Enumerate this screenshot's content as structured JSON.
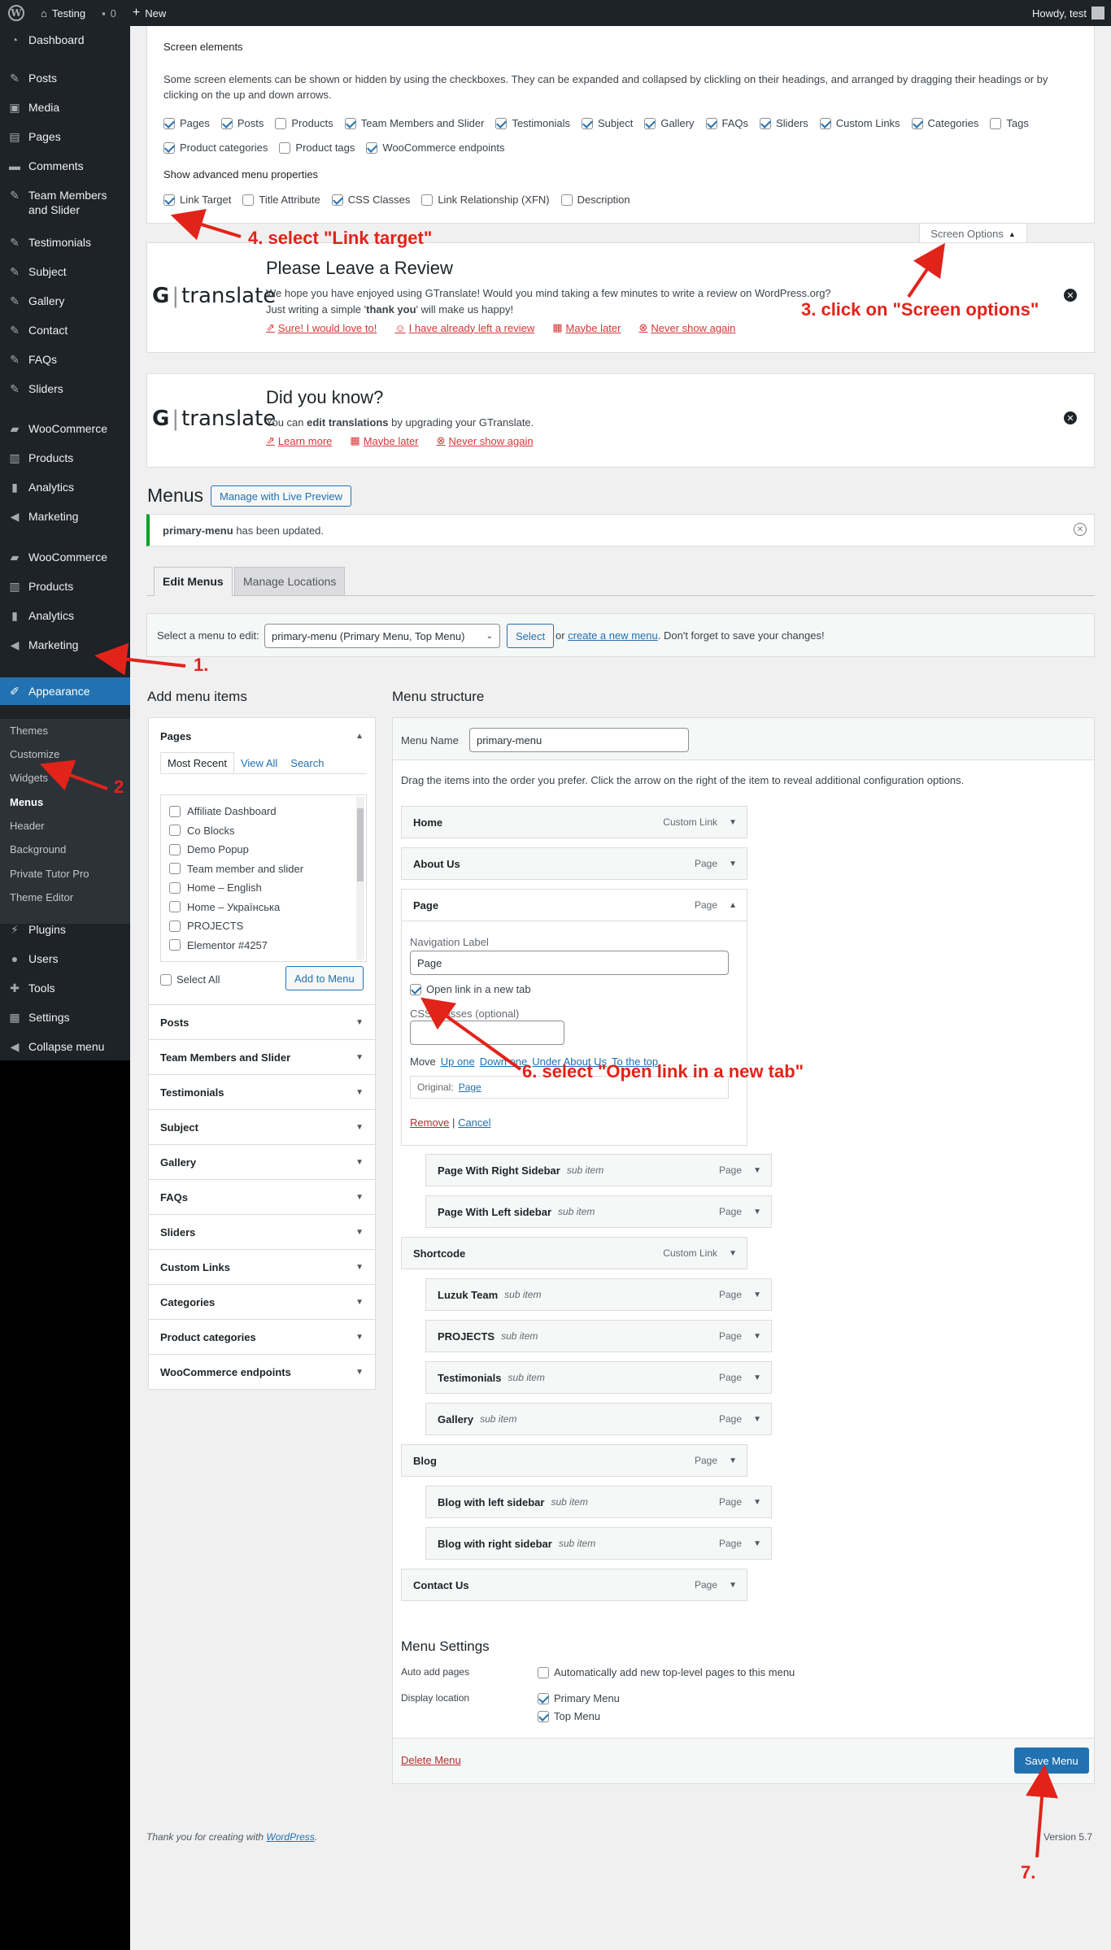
{
  "adminbar": {
    "site_name": "Testing",
    "comments_count": "0",
    "new_label": "New",
    "howdy": "Howdy, test"
  },
  "sidebar": {
    "items": [
      {
        "label": "Dashboard",
        "icon": "dashboard-icon"
      },
      {
        "label": "Posts",
        "icon": "pin-icon"
      },
      {
        "label": "Media",
        "icon": "media-icon"
      },
      {
        "label": "Pages",
        "icon": "page-icon"
      },
      {
        "label": "Comments",
        "icon": "comment-icon"
      },
      {
        "label": "Team Members\nand Slider",
        "icon": "pin-icon"
      },
      {
        "label": "Testimonials",
        "icon": "pin-icon"
      },
      {
        "label": "Subject",
        "icon": "pin-icon"
      },
      {
        "label": "Gallery",
        "icon": "pin-icon"
      },
      {
        "label": "Contact",
        "icon": "pin-icon"
      },
      {
        "label": "FAQs",
        "icon": "pin-icon"
      },
      {
        "label": "Sliders",
        "icon": "pin-icon"
      },
      {
        "label": "WooCommerce",
        "icon": "woo-icon"
      },
      {
        "label": "Products",
        "icon": "archive-icon"
      },
      {
        "label": "Analytics",
        "icon": "chart-icon"
      },
      {
        "label": "Marketing",
        "icon": "megaphone-icon"
      },
      {
        "label": "WooCommerce",
        "icon": "woo-icon"
      },
      {
        "label": "Products",
        "icon": "archive-icon"
      },
      {
        "label": "Analytics",
        "icon": "chart-icon"
      },
      {
        "label": "Marketing",
        "icon": "megaphone-icon"
      },
      {
        "label": "Appearance",
        "icon": "brush-icon"
      }
    ],
    "appearance_sub": [
      "Themes",
      "Customize",
      "Widgets",
      "Menus",
      "Header",
      "Background",
      "Private Tutor Pro",
      "Theme Editor"
    ],
    "after": [
      {
        "label": "Plugins",
        "icon": "plugin-icon"
      },
      {
        "label": "Users",
        "icon": "users-icon"
      },
      {
        "label": "Tools",
        "icon": "tools-icon"
      },
      {
        "label": "Settings",
        "icon": "settings-icon"
      },
      {
        "label": "Collapse menu",
        "icon": "collapse-icon"
      }
    ]
  },
  "screen_options": {
    "heading": "Screen elements",
    "description": "Some screen elements can be shown or hidden by using the checkboxes. They can be expanded and collapsed by clickling on their headings, and arranged by dragging their headings or by clicking on the up and down arrows.",
    "elements": [
      {
        "label": "Pages",
        "checked": true
      },
      {
        "label": "Posts",
        "checked": true
      },
      {
        "label": "Products",
        "checked": false
      },
      {
        "label": "Team Members and Slider",
        "checked": true
      },
      {
        "label": "Testimonials",
        "checked": true
      },
      {
        "label": "Subject",
        "checked": true
      },
      {
        "label": "Gallery",
        "checked": true
      },
      {
        "label": "FAQs",
        "checked": true
      },
      {
        "label": "Sliders",
        "checked": true
      },
      {
        "label": "Custom Links",
        "checked": true
      },
      {
        "label": "Categories",
        "checked": true
      },
      {
        "label": "Tags",
        "checked": false
      }
    ],
    "elements_row2": [
      {
        "label": "Product categories",
        "checked": true
      },
      {
        "label": "Product tags",
        "checked": false
      },
      {
        "label": "WooCommerce endpoints",
        "checked": true
      }
    ],
    "advanced_heading": "Show advanced menu properties",
    "advanced": [
      {
        "label": "Link Target",
        "checked": true
      },
      {
        "label": "Title Attribute",
        "checked": false
      },
      {
        "label": "CSS Classes",
        "checked": true
      },
      {
        "label": "Link Relationship (XFN)",
        "checked": false
      },
      {
        "label": "Description",
        "checked": false
      }
    ],
    "tab_label": "Screen Options"
  },
  "review_notice": {
    "logo_g": "G",
    "logo_text": "translate",
    "title": "Please Leave a Review",
    "line1": "We hope you have enjoyed using GTranslate! Would you mind taking a few minutes to write a review on WordPress.org?",
    "line2_pre": "Just writing a simple '",
    "line2_bold": "thank you",
    "line2_post": "' will make us happy!",
    "links": [
      "Sure! I would love to!",
      "I have already left a review",
      "Maybe later",
      "Never show again"
    ]
  },
  "dyk_notice": {
    "logo_g": "G",
    "logo_text": "translate",
    "title": "Did you know?",
    "line_pre": "You can ",
    "line_bold": "edit translations",
    "line_post": " by upgrading your GTranslate.",
    "links": [
      "Learn more",
      "Maybe later",
      "Never show again"
    ]
  },
  "menus": {
    "page_title": "Menus",
    "live_preview": "Manage with Live Preview",
    "updated_bold": "primary-menu",
    "updated_text": " has been updated.",
    "tab_edit": "Edit Menus",
    "tab_locations": "Manage Locations",
    "select_label": "Select a menu to edit:",
    "select_value": "primary-menu (Primary Menu, Top Menu)",
    "select_btn": "Select",
    "or_text": "or",
    "create_link": "create a new menu",
    "after_create": ". Don't forget to save your changes!"
  },
  "add_items": {
    "heading": "Add menu items",
    "pages_title": "Pages",
    "tabs": [
      "Most Recent",
      "View All",
      "Search"
    ],
    "pages": [
      "Affiliate Dashboard",
      "Co Blocks",
      "Demo Popup",
      "Team member and slider",
      "Home – English",
      "Home – Українська",
      "PROJECTS",
      "Elementor #4257"
    ],
    "select_all": "Select All",
    "add_btn": "Add to Menu",
    "sections": [
      "Posts",
      "Team Members and Slider",
      "Testimonials",
      "Subject",
      "Gallery",
      "FAQs",
      "Sliders",
      "Custom Links",
      "Categories",
      "Product categories",
      "WooCommerce endpoints"
    ]
  },
  "structure": {
    "heading": "Menu structure",
    "name_label": "Menu Name",
    "name_value": "primary-menu",
    "instructions": "Drag the items into the order you prefer. Click the arrow on the right of the item to reveal additional configuration options.",
    "items": [
      {
        "title": "Home",
        "type": "Custom Link",
        "sub": ""
      },
      {
        "title": "About Us",
        "type": "Page",
        "sub": ""
      },
      {
        "title": "Page",
        "type": "Page",
        "sub": ""
      },
      {
        "title": "Page With Right Sidebar",
        "type": "Page",
        "sub": "sub item"
      },
      {
        "title": "Page With Left sidebar",
        "type": "Page",
        "sub": "sub item"
      },
      {
        "title": "Shortcode",
        "type": "Custom Link",
        "sub": ""
      },
      {
        "title": "Luzuk Team",
        "type": "Page",
        "sub": "sub item"
      },
      {
        "title": "PROJECTS",
        "type": "Page",
        "sub": "sub item"
      },
      {
        "title": "Testimonials",
        "type": "Page",
        "sub": "sub item"
      },
      {
        "title": "Gallery",
        "type": "Page",
        "sub": "sub item"
      },
      {
        "title": "Blog",
        "type": "Page",
        "sub": ""
      },
      {
        "title": "Blog with left sidebar",
        "type": "Page",
        "sub": "sub item"
      },
      {
        "title": "Blog with right sidebar",
        "type": "Page",
        "sub": "sub item"
      },
      {
        "title": "Contact Us",
        "type": "Page",
        "sub": ""
      }
    ],
    "edit": {
      "nav_label": "Navigation Label",
      "nav_value": "Page",
      "new_tab": "Open link in a new tab",
      "css_label": "CSS Classes (optional)",
      "move": "Move",
      "move_links": [
        "Up one",
        "Down one",
        "Under About Us",
        "To the top"
      ],
      "original": "Original:",
      "original_link": "Page",
      "remove": "Remove",
      "sep": "|",
      "cancel": "Cancel"
    },
    "settings_heading": "Menu Settings",
    "auto_add_label": "Auto add pages",
    "auto_add_text": "Automatically add new top-level pages to this menu",
    "display_label": "Display location",
    "locations": [
      "Primary Menu",
      "Top Menu"
    ],
    "delete": "Delete Menu",
    "save": "Save Menu"
  },
  "footer": {
    "thanks_pre": "Thank you for creating with ",
    "thanks_link": "WordPress",
    "thanks_post": ".",
    "version": "Version 5.7"
  },
  "annotations": [
    "1.",
    "2",
    "3. click on \"Screen options\"",
    "4. select \"Link target\"",
    "6. select \"Open link in a new tab\"",
    "7."
  ],
  "colors": {
    "accent": "#2271b1",
    "admin_dark": "#1d2327",
    "annotation_red": "#e2231a",
    "notice_link_red": "#d63638",
    "success_green": "#00a32a"
  }
}
